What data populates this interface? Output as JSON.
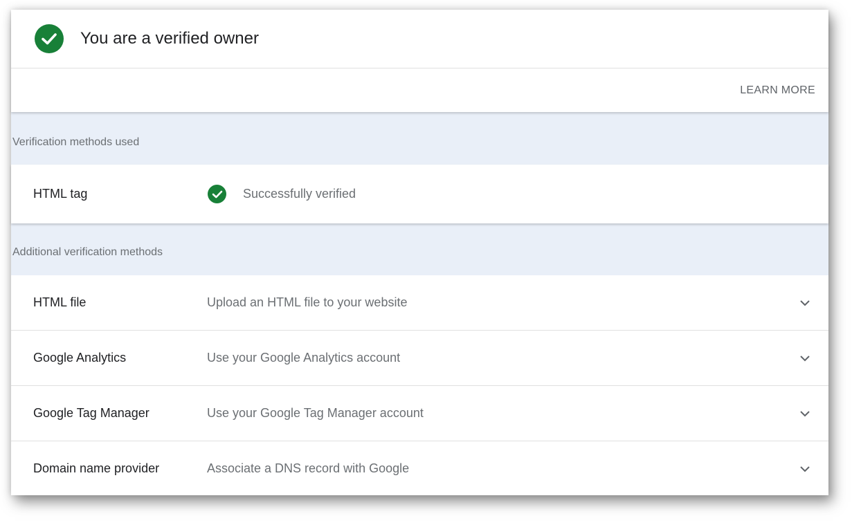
{
  "owner": {
    "title": "You are a verified owner",
    "learn_more_label": "LEARN MORE"
  },
  "used_section": {
    "label": "Verification methods used",
    "methods": [
      {
        "name": "HTML tag",
        "status": "Successfully verified"
      }
    ]
  },
  "additional_section": {
    "label": "Additional verification methods",
    "methods": [
      {
        "name": "HTML file",
        "description": "Upload an HTML file to your website"
      },
      {
        "name": "Google Analytics",
        "description": "Use your Google Analytics account"
      },
      {
        "name": "Google Tag Manager",
        "description": "Use your Google Tag Manager account"
      },
      {
        "name": "Domain name provider",
        "description": "Associate a DNS record with Google"
      }
    ]
  },
  "icons": {
    "verified": "check-circle-icon",
    "expand": "chevron-down-icon"
  },
  "colors": {
    "success_green": "#188038",
    "section_background": "#e9eff8"
  }
}
